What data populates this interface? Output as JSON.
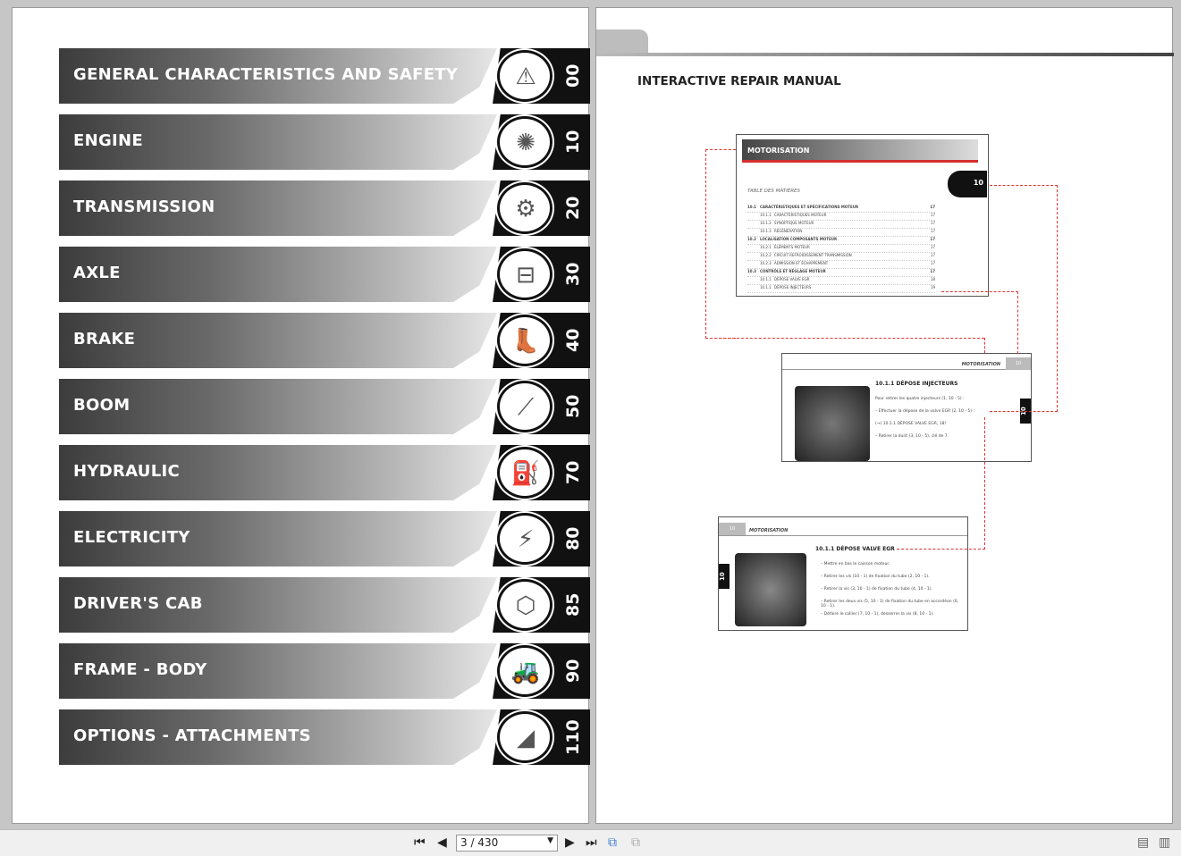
{
  "chapters": [
    {
      "title": "GENERAL CHARACTERISTICS AND SAFETY",
      "number": "00",
      "icon": "⚠"
    },
    {
      "title": "ENGINE",
      "number": "10",
      "icon": "✺"
    },
    {
      "title": "TRANSMISSION",
      "number": "20",
      "icon": "⚙"
    },
    {
      "title": "AXLE",
      "number": "30",
      "icon": "⊟"
    },
    {
      "title": "BRAKE",
      "number": "40",
      "icon": "👢"
    },
    {
      "title": "BOOM",
      "number": "50",
      "icon": "⟋"
    },
    {
      "title": "HYDRAULIC",
      "number": "70",
      "icon": "⛽"
    },
    {
      "title": "ELECTRICITY",
      "number": "80",
      "icon": "⚡"
    },
    {
      "title": "DRIVER'S CAB",
      "number": "85",
      "icon": "⬡"
    },
    {
      "title": "FRAME - BODY",
      "number": "90",
      "icon": "🚜"
    },
    {
      "title": "OPTIONS - ATTACHMENTS",
      "number": "110",
      "icon": "◢"
    }
  ],
  "right_page": {
    "title": "INTERACTIVE REPAIR MANUAL",
    "toc_page": {
      "header": "MOTORISATION",
      "tab": "10",
      "subtitle": "TABLE DES MATIÈRES",
      "entries": [
        {
          "n": "10.1",
          "t": "CARACTÉRISTIQUES ET SPÉCIFICATIONS MOTEUR",
          "p": "17",
          "bold": true
        },
        {
          "n": "10.1.1",
          "t": "CARACTÉRISTIQUES MOTEUR",
          "p": "17"
        },
        {
          "n": "10.1.2",
          "t": "SYNOPTIQUE MOTEUR",
          "p": "17"
        },
        {
          "n": "10.1.3",
          "t": "RÉGÉNÉRATION",
          "p": "17"
        },
        {
          "n": "10.2",
          "t": "LOCALISATION COMPOSANTS MOTEUR",
          "p": "17",
          "bold": true
        },
        {
          "n": "10.2.1",
          "t": "ÉLÉMENTS MOTEUR",
          "p": "17"
        },
        {
          "n": "10.2.2",
          "t": "CIRCUIT REFROIDISSEMENT TRANSMISSION",
          "p": "17"
        },
        {
          "n": "10.2.3",
          "t": "ADMISSION ET ÉCHAPPEMENT",
          "p": "17"
        },
        {
          "n": "10.3",
          "t": "CONTRÔLE ET RÉGLAGE MOTEUR",
          "p": "17",
          "bold": true
        },
        {
          "n": "10.1.1",
          "t": "DÉPOSE VALVE EGR",
          "p": "18"
        },
        {
          "n": "10.1.1",
          "t": "DÉPOSE INJECTEURS",
          "p": "19"
        }
      ]
    },
    "injector_page": {
      "header": "MOTORISATION",
      "tab": "10",
      "heading": "10.1.1   DÉPOSE INJECTEURS",
      "lines": [
        "Pour retirer les quatre injecteurs (1, 10 - 5) :",
        "– Effectuer la dépose de la valve EGR (2, 10 - 5) :",
        "(→)  10.1.1 DÉPOSE VALVE EGR, 18!",
        "– Retirer la durit (3, 10 - 5), clé de 7."
      ]
    },
    "egr_page": {
      "header": "MOTORISATION",
      "tab": "10",
      "heading": "10.1.1   DÉPOSE VALVE EGR",
      "lines": [
        "– Mettre en bas le caisson moteur.",
        "– Retirer les vis (10 - 1) de fixation du tube (2, 10 - 1).",
        "– Retirer la vis (3, 10 - 1) de fixation du tube (4, 10 - 1).",
        "– Retirer les deux vis (5, 10 - 1) de fixation du tube en accordéon (6, 10 - 1).",
        "– Défaire le collier (7, 10 - 1), desserrer la vis (8, 10 - 1)."
      ]
    }
  },
  "toolbar": {
    "page_value": "3 / 430"
  },
  "colors": {
    "accent": "#d32f2f"
  }
}
